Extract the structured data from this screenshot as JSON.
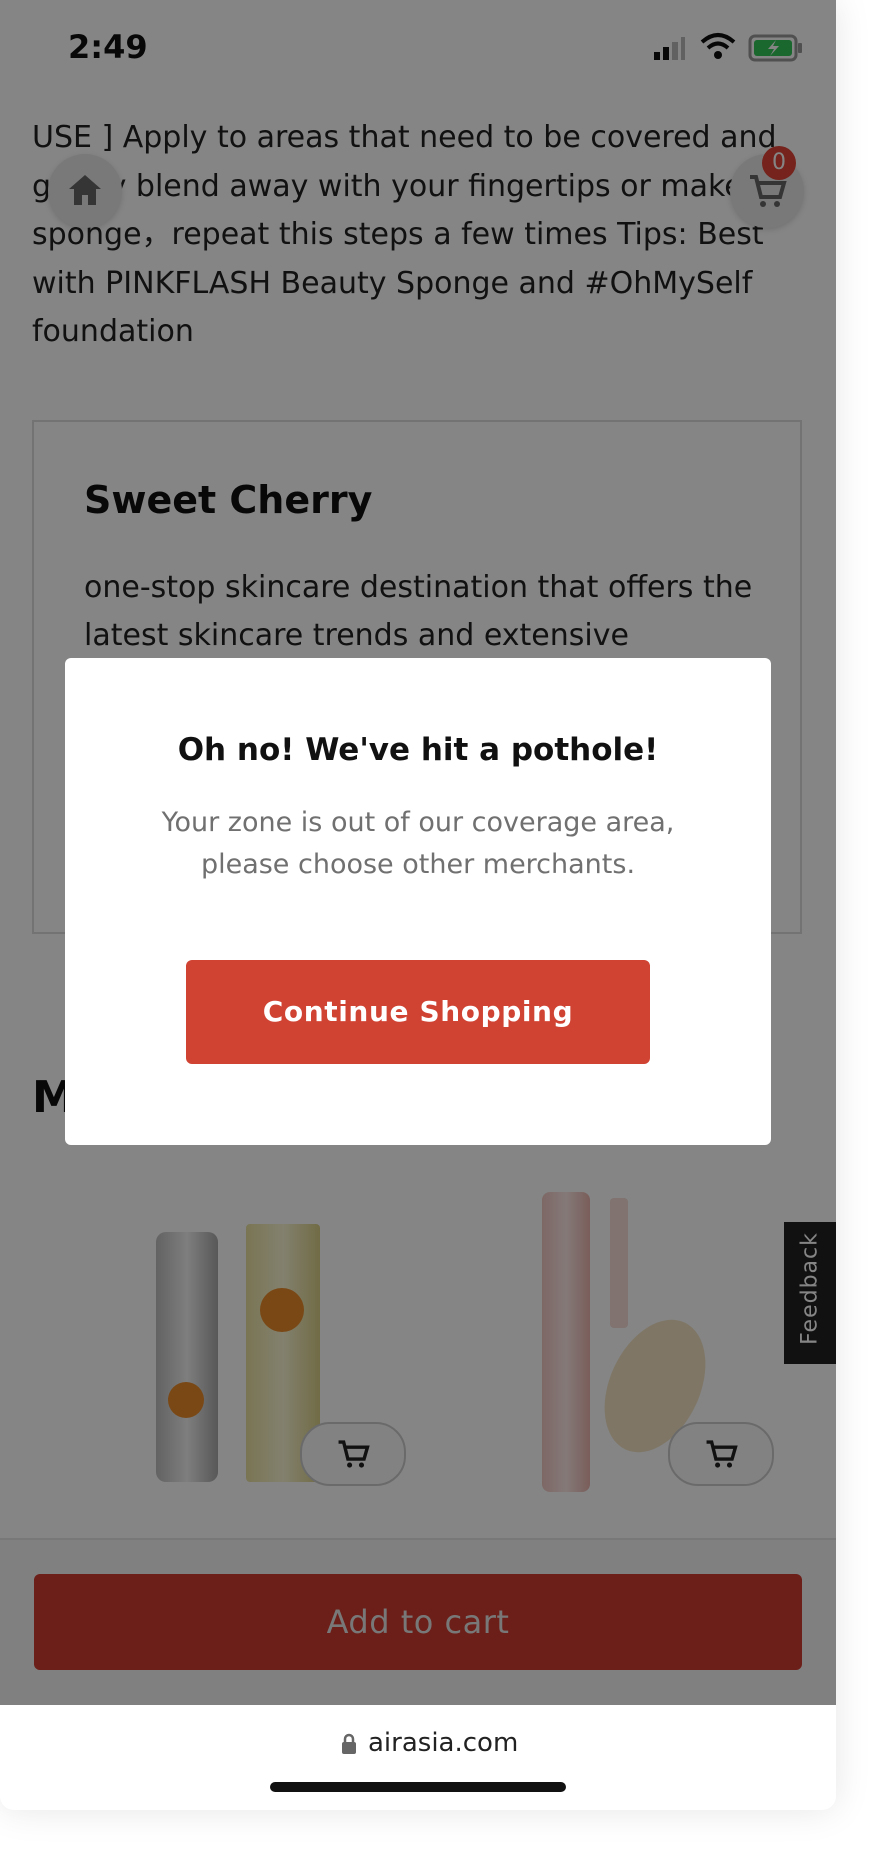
{
  "status_bar": {
    "time": "2:49"
  },
  "description": {
    "partial_top": "...",
    "text": "USE ] Apply to areas that need to be covered and gently blend away with your fingertips or makeup sponge，repeat this steps a few times Tips: Best with PINKFLASH Beauty Sponge and #OhMySelf foundation"
  },
  "header": {
    "cart_count": "0"
  },
  "merchant": {
    "name": "Sweet Cherry",
    "text": "one-stop skincare destination that offers the latest skincare trends and extensive"
  },
  "section_heading_partial": "M",
  "modal": {
    "title": "Oh no! We've hit a pothole!",
    "message": "Your zone is out of our coverage area, please choose other merchants.",
    "button": "Continue Shopping"
  },
  "feedback_label": "Feedback",
  "add_to_cart_label": "Add to cart",
  "browser": {
    "url": "airasia.com"
  },
  "icons": {
    "home": "home-icon",
    "cart": "cart-icon",
    "lock": "lock-icon",
    "wifi": "wifi-icon",
    "battery": "battery-icon",
    "signal": "signal-icon"
  },
  "colors": {
    "accent": "#d04333",
    "overlay": "rgba(0,0,0,0.48)"
  }
}
